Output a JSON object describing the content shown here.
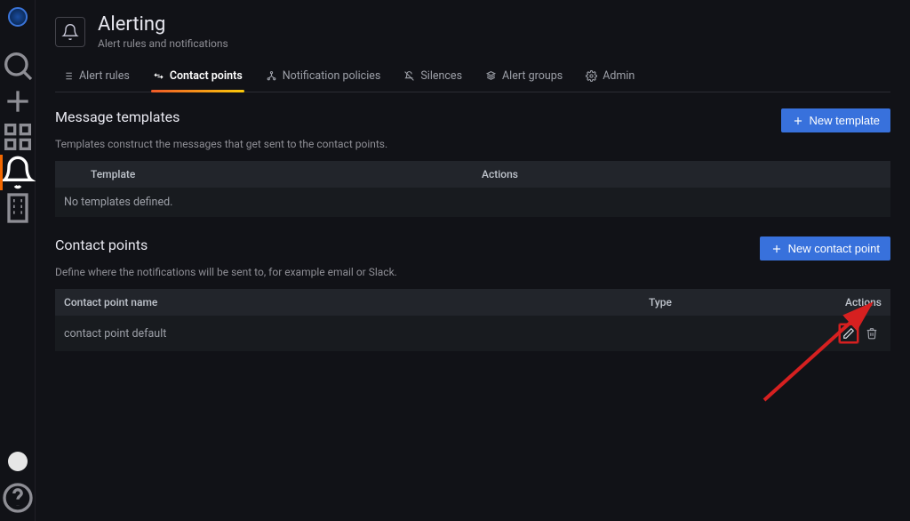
{
  "sidebar": {
    "items": [
      {
        "name": "search-icon"
      },
      {
        "name": "plus-icon"
      },
      {
        "name": "dashboards-icon"
      },
      {
        "name": "alerting-icon",
        "active": true
      },
      {
        "name": "building-icon"
      }
    ]
  },
  "header": {
    "title": "Alerting",
    "subtitle": "Alert rules and notifications"
  },
  "tabs": [
    {
      "label": "Alert rules",
      "icon": "list"
    },
    {
      "label": "Contact points",
      "icon": "exchange",
      "active": true
    },
    {
      "label": "Notification policies",
      "icon": "sitemap"
    },
    {
      "label": "Silences",
      "icon": "bell-slash"
    },
    {
      "label": "Alert groups",
      "icon": "layer"
    },
    {
      "label": "Admin",
      "icon": "cog"
    }
  ],
  "templates": {
    "title": "Message templates",
    "desc": "Templates construct the messages that get sent to the contact points.",
    "btn": "New template",
    "columns": {
      "template": "Template",
      "actions": "Actions"
    },
    "empty": "No templates defined."
  },
  "contacts": {
    "title": "Contact points",
    "desc": "Define where the notifications will be sent to, for example email or Slack.",
    "btn": "New contact point",
    "columns": {
      "name": "Contact point name",
      "type": "Type",
      "actions": "Actions"
    },
    "rows": [
      {
        "name": "contact point default",
        "type": ""
      }
    ]
  }
}
